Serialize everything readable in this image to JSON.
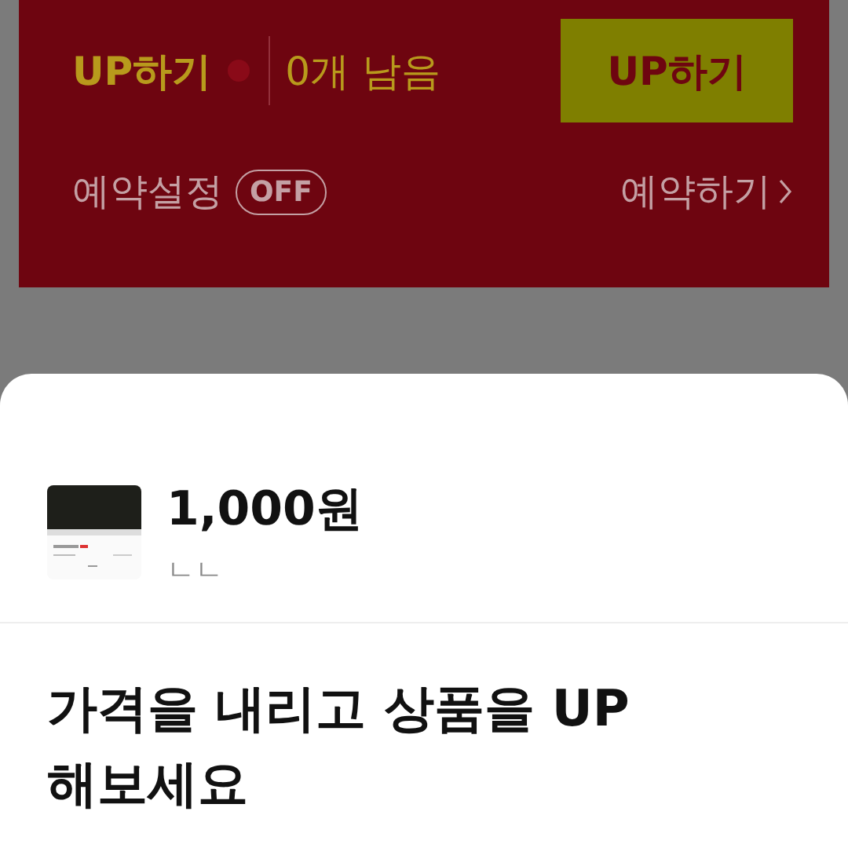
{
  "up_panel": {
    "title": "UP하기",
    "remaining": "0개 남음",
    "button": "UP하기",
    "schedule_label": "예약설정",
    "schedule_toggle": "OFF",
    "schedule_link": "예약하기"
  },
  "sheet": {
    "product": {
      "price": "1,000원",
      "name": "ㄴㄴ"
    },
    "headline": "가격을 내리고 상품을 UP해보세요"
  }
}
